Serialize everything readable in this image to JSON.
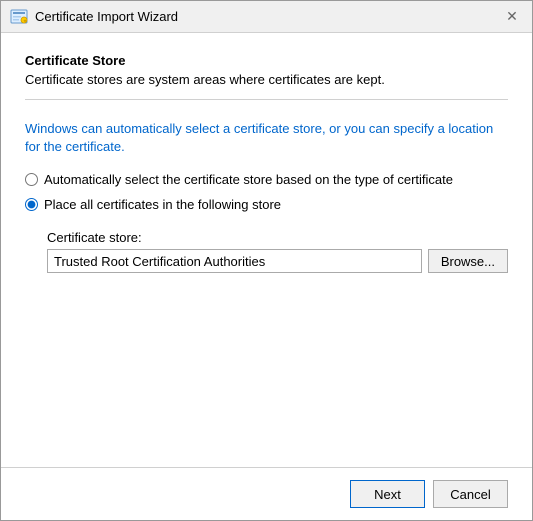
{
  "window": {
    "title": "Certificate Import Wizard",
    "close_label": "✕"
  },
  "header": {
    "section_title": "Certificate Store",
    "section_desc": "Certificate stores are system areas where certificates are kept."
  },
  "main": {
    "info_text": "Windows can automatically select a certificate store, or you can specify a location for the certificate.",
    "radio_auto_label": "Automatically select the certificate store based on the type of certificate",
    "radio_manual_label": "Place all certificates in the following store",
    "cert_store_label": "Certificate store:",
    "cert_store_value": "Trusted Root Certification Authorities",
    "browse_label": "Browse..."
  },
  "footer": {
    "next_label": "Next",
    "cancel_label": "Cancel"
  }
}
